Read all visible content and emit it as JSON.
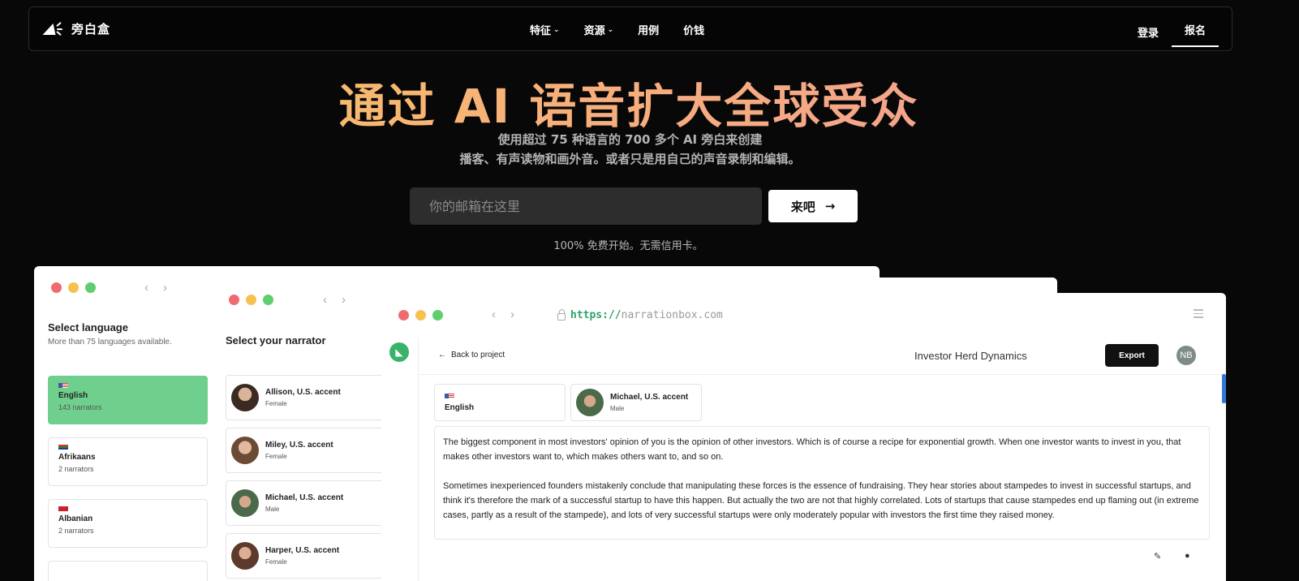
{
  "brand": {
    "name": "旁白盒"
  },
  "nav": {
    "items": [
      {
        "label": "特征",
        "has_dropdown": true
      },
      {
        "label": "资源",
        "has_dropdown": true
      },
      {
        "label": "用例",
        "has_dropdown": false
      },
      {
        "label": "价钱",
        "has_dropdown": false
      }
    ],
    "login": "登录",
    "signup": "报名"
  },
  "hero": {
    "title": "通过 AI 语音扩大全球受众",
    "subtitle_line1": "使用超过 75 种语言的 700 多个 AI 旁白来创建",
    "subtitle_line2": "播客、有声读物和画外音。或者只是用自己的声音录制和编辑。",
    "email_placeholder": "你的邮箱在这里",
    "cta": "来吧",
    "note": "100% 免费开始。无需信用卡。"
  },
  "colors": {
    "accent_green": "#6fd08d",
    "brand_green": "#3bb26b",
    "gradient_start": "#f7c560",
    "gradient_end": "#f29a9a"
  },
  "language_panel": {
    "title": "Select language",
    "subtitle": "More than 75 languages available.",
    "languages": [
      {
        "name": "English",
        "count": "143 narrators",
        "selected": true
      },
      {
        "name": "Afrikaans",
        "count": "2 narrators",
        "selected": false
      },
      {
        "name": "Albanian",
        "count": "2 narrators",
        "selected": false
      }
    ]
  },
  "narrator_panel": {
    "title": "Select your narrator",
    "narrators": [
      {
        "name": "Allison, U.S. accent",
        "gender": "Female"
      },
      {
        "name": "Miley, U.S. accent",
        "gender": "Female"
      },
      {
        "name": "Michael, U.S. accent",
        "gender": "Male"
      },
      {
        "name": "Harper, U.S. accent",
        "gender": "Female"
      }
    ]
  },
  "editor": {
    "url_scheme": "https://",
    "url_host": "narrationbox.com",
    "back_label": "Back to project",
    "project_title": "Investor Herd Dynamics",
    "export_label": "Export",
    "user_initials": "NB",
    "selected_language": "English",
    "selected_narrator": {
      "name": "Michael, U.S. accent",
      "gender": "Male"
    },
    "paragraphs": [
      "The biggest component in most investors' opinion of you is the opinion of other investors. Which is of course a recipe for exponential growth. When one investor wants to invest in you, that makes other investors want to, which makes others want to, and so on.",
      "Sometimes inexperienced founders mistakenly conclude that manipulating these forces is the essence of fundraising. They hear stories about stampedes to invest in successful startups, and think it's therefore the mark of a successful startup to have this happen. But actually the two are not that highly correlated. Lots of startups that cause stampedes end up flaming out (in extreme cases, partly as a result of the stampede), and lots of very successful startups were only moderately popular with investors the first time they raised money."
    ]
  }
}
